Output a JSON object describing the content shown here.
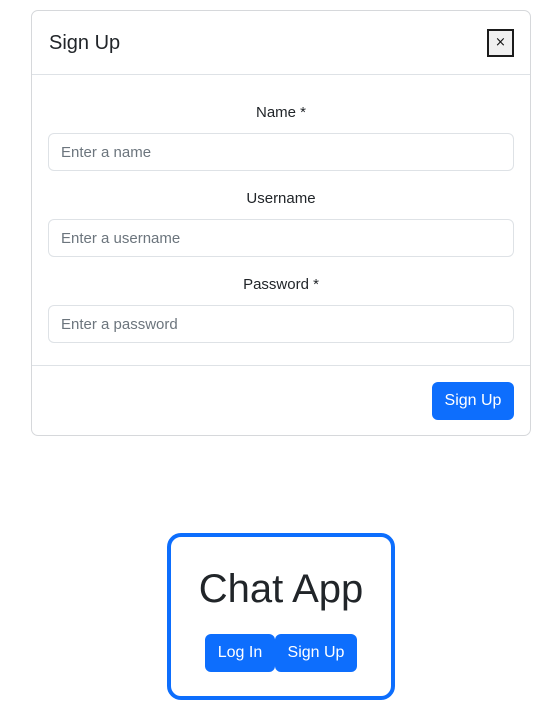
{
  "modal": {
    "title": "Sign Up",
    "close_label": "×",
    "fields": [
      {
        "label": "Name *",
        "placeholder": "Enter a name"
      },
      {
        "label": "Username",
        "placeholder": "Enter a username"
      },
      {
        "label": "Password *",
        "placeholder": "Enter a password"
      }
    ],
    "submit_label": "Sign Up"
  },
  "card": {
    "title": "Chat App",
    "login_label": "Log In",
    "signup_label": "Sign Up"
  },
  "colors": {
    "primary": "#0d6efd",
    "text": "#212529",
    "border": "#dee2e6",
    "placeholder": "#6c757d"
  }
}
